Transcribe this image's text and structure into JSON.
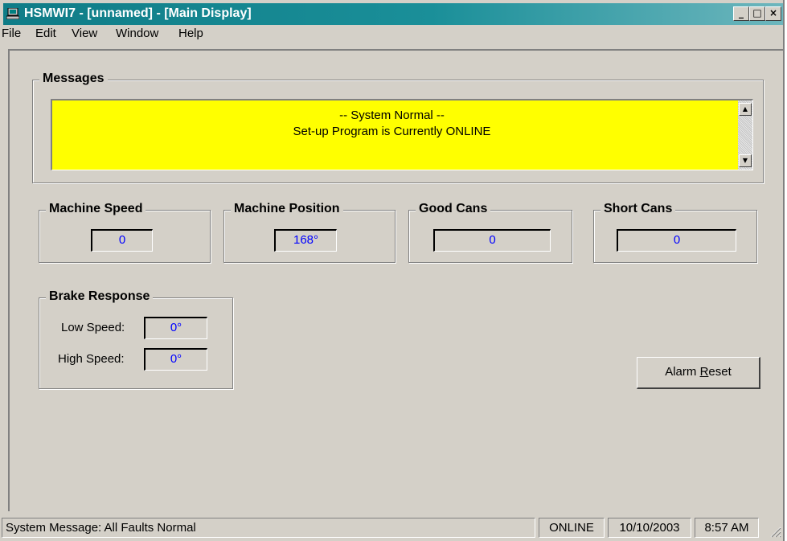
{
  "window": {
    "title": "HSMWI7 - [unnamed] - [Main Display]",
    "minimize": "_",
    "maximize": "□",
    "close": "×"
  },
  "menu": [
    "File",
    "Edit",
    "View",
    "Window",
    "Help"
  ],
  "messages": {
    "label": "Messages",
    "lines": [
      "-- System Normal --",
      "Set-up Program is Currently ONLINE"
    ],
    "background_color": "#ffff00"
  },
  "machine_speed": {
    "label": "Machine Speed",
    "value": "0"
  },
  "machine_position": {
    "label": "Machine Position",
    "value": "168°"
  },
  "good_cans": {
    "label": "Good Cans",
    "value": "0"
  },
  "short_cans": {
    "label": "Short Cans",
    "value": "0"
  },
  "brake_response": {
    "label": "Brake Response",
    "low_speed_label": "Low Speed:",
    "low_speed_value": "0°",
    "high_speed_label": "High Speed:",
    "high_speed_value": "0°"
  },
  "alarm_reset": {
    "prefix": "Alarm ",
    "accel": "R",
    "suffix": "eset"
  },
  "status": {
    "message": "System Message:  All Faults Normal",
    "mode": "ONLINE",
    "date": "10/10/2003",
    "time": "8:57 AM"
  },
  "colors": {
    "titlebar": "#0f7c87",
    "value_text": "#0000ff",
    "face": "#d4d0c8"
  }
}
